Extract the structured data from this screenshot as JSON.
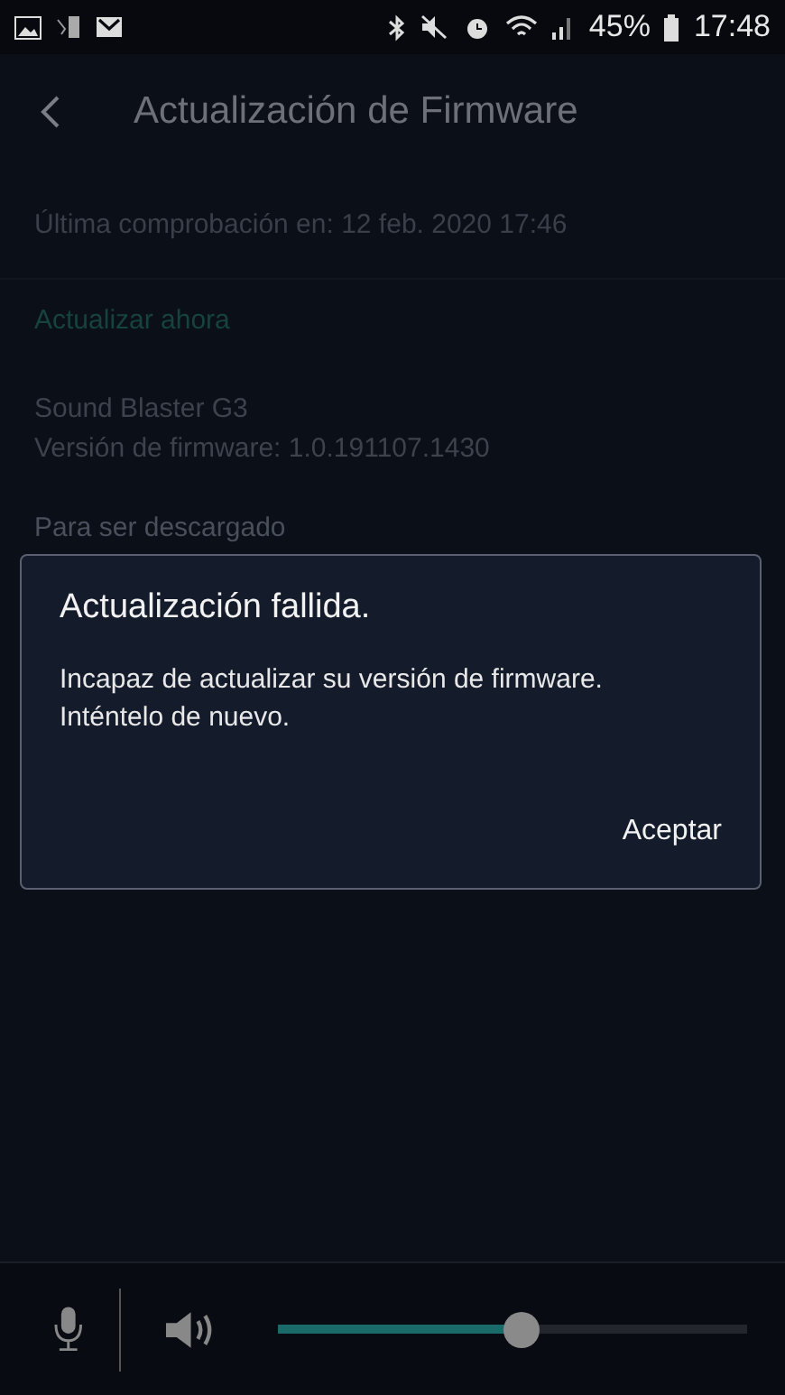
{
  "status_bar": {
    "battery": "45%",
    "time": "17:48"
  },
  "header": {
    "title": "Actualización de Firmware"
  },
  "last_check": "Última comprobación en: 12 feb. 2020 17:46",
  "update_link": "Actualizar ahora",
  "device": {
    "name": "Sound Blaster G3",
    "firmware": "Versión de firmware: 1.0.191107.1430"
  },
  "download_label": "Para ser descargado",
  "dialog": {
    "title": "Actualización fallida.",
    "message": "Incapaz de actualizar su versión de firmware. Inténtelo de nuevo.",
    "button": "Aceptar"
  },
  "volume": {
    "level": 0.52
  }
}
